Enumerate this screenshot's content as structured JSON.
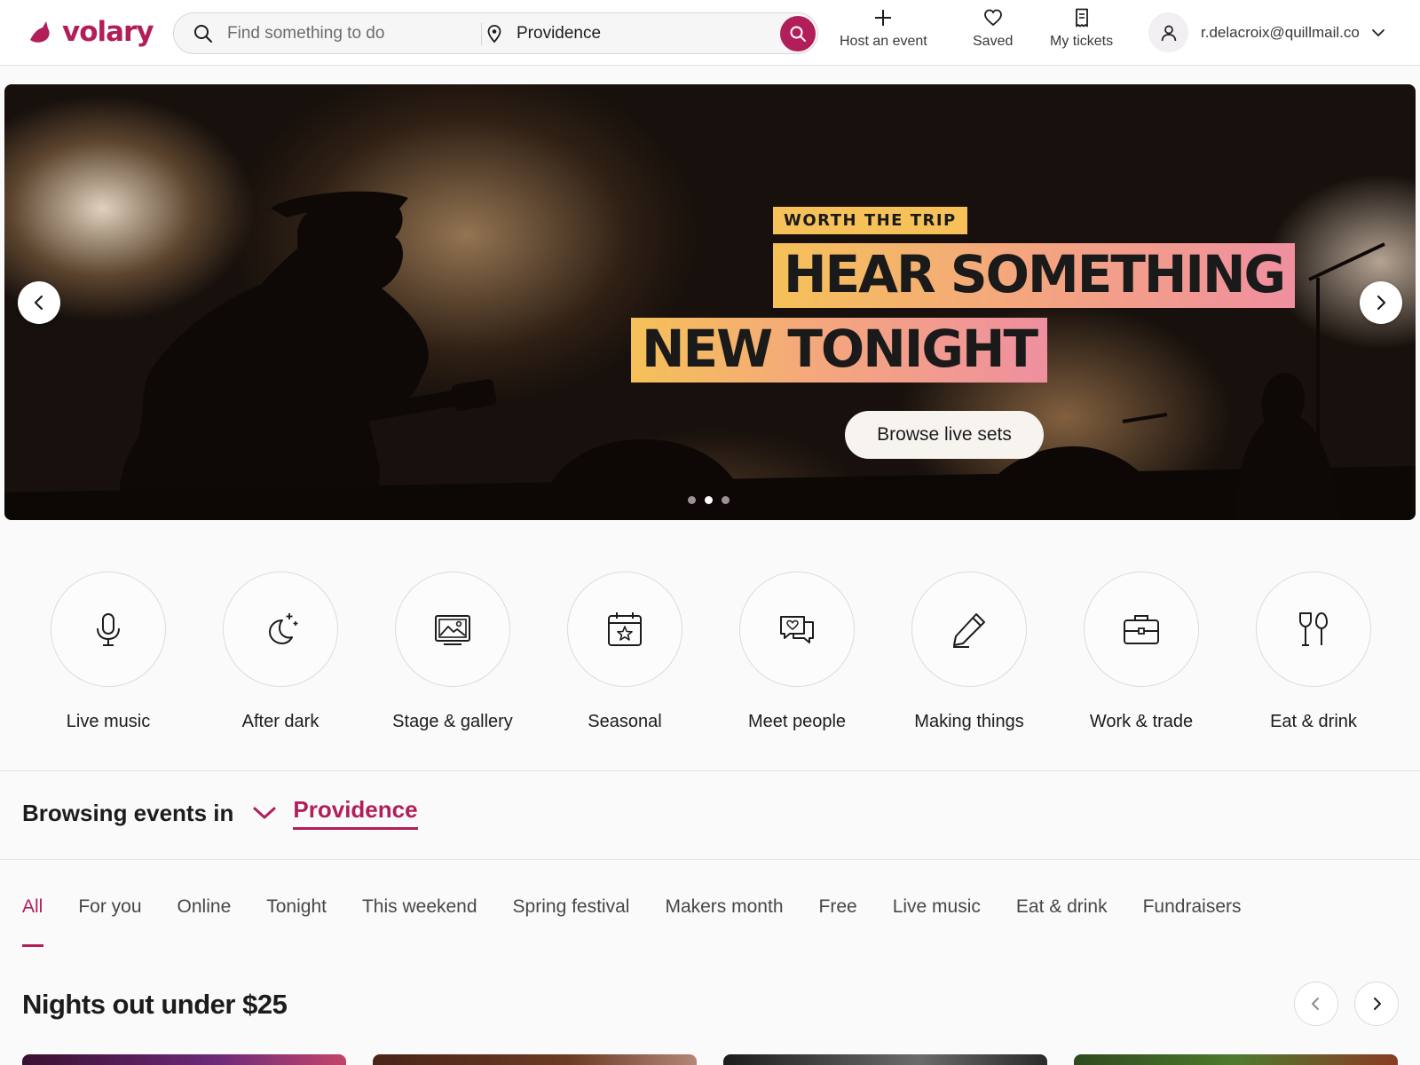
{
  "brand": {
    "name": "volary",
    "accent": "#b21e5a"
  },
  "search": {
    "placeholder": "Find something to do",
    "location_value": "Providence"
  },
  "nav": {
    "host_label": "Host an event",
    "saved_label": "Saved",
    "tickets_label": "My tickets"
  },
  "account": {
    "email": "r.delacroix@quillmail.co"
  },
  "hero": {
    "eyebrow": "WORTH THE TRIP",
    "headline_line1": "HEAR SOMETHING",
    "headline_line2": "NEW TONIGHT",
    "cta_label": "Browse live sets",
    "slide_count": 3,
    "active_slide": 2
  },
  "categories": [
    {
      "label": "Live music",
      "icon": "microphone-icon"
    },
    {
      "label": "After dark",
      "icon": "moon-icon"
    },
    {
      "label": "Stage & gallery",
      "icon": "picture-icon"
    },
    {
      "label": "Seasonal",
      "icon": "calendar-star-icon"
    },
    {
      "label": "Meet people",
      "icon": "chat-bubbles-icon"
    },
    {
      "label": "Making things",
      "icon": "pencil-icon"
    },
    {
      "label": "Work & trade",
      "icon": "briefcase-icon"
    },
    {
      "label": "Eat & drink",
      "icon": "utensils-icon"
    }
  ],
  "browsing": {
    "label": "Browsing events in",
    "city": "Providence"
  },
  "tabs": [
    "All",
    "For you",
    "Online",
    "Tonight",
    "This weekend",
    "Spring festival",
    "Makers month",
    "Free",
    "Live music",
    "Eat & drink",
    "Fundraisers"
  ],
  "active_tab": "All",
  "section": {
    "title": "Nights out under $25"
  }
}
